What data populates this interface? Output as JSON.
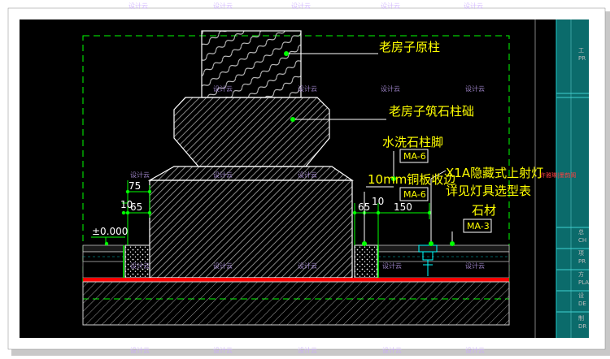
{
  "labels": {
    "original_column": "老房子原柱",
    "stone_base": "老房子筑石柱础",
    "washed_stone_foot": "水洗石柱脚",
    "copper_trim": "10mm铜板收边",
    "uplight": "X1A隐藏式上射灯",
    "see_lamp_table": "详见灯具选型表",
    "stone": "石材"
  },
  "tags": {
    "ma6_top": "MA-6",
    "ma6_bottom": "MA-6",
    "ma3": "MA-3"
  },
  "dimensions": {
    "d75": "75",
    "d10_left": "10",
    "d65_left": "65",
    "level": "±0.000",
    "d65_right": "65",
    "d10_right": "10",
    "d150": "150"
  },
  "side_panel_fragments": [
    "工",
    "PR",
    "总",
    "CH",
    "项",
    "PR",
    "方",
    "PLA",
    "设",
    "DE",
    "制",
    "DR"
  ],
  "red_note": "许雅琳|墨韵阁",
  "watermark": "设计云",
  "colors": {
    "background": "#000000",
    "line_green": "#00ff00",
    "text_yellow": "#ffff00",
    "hatch_gray": "#bdbdbd",
    "red_line": "#ff0000",
    "panel_teal": "#0b6b6b",
    "frame_white": "#ffffff"
  }
}
